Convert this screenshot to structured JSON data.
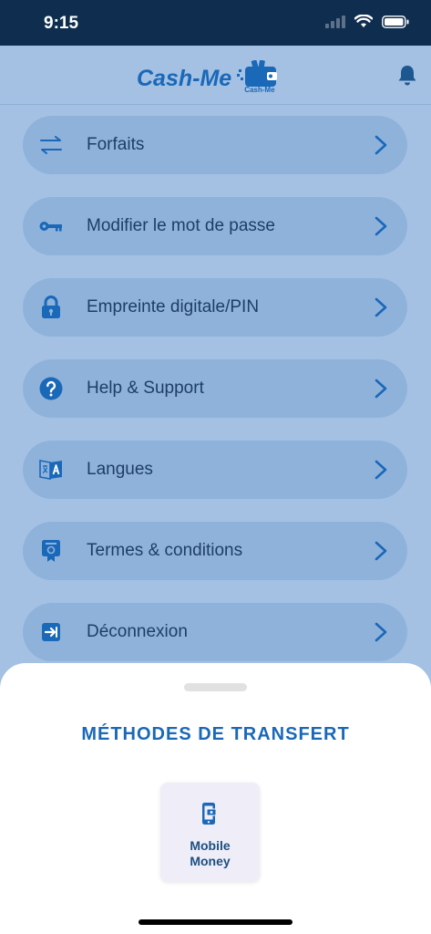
{
  "status_bar": {
    "time": "9:15"
  },
  "header": {
    "brand": "Cash-Me",
    "logo_caption": "Cash-Me"
  },
  "menu": {
    "items": [
      {
        "label": "Forfaits",
        "icon": "transfer-arrows-icon"
      },
      {
        "label": "Modifier le mot de passe",
        "icon": "key-icon"
      },
      {
        "label": "Empreinte digitale/PIN",
        "icon": "lock-icon"
      },
      {
        "label": "Help & Support",
        "icon": "help-icon"
      },
      {
        "label": "Langues",
        "icon": "translate-icon"
      },
      {
        "label": "Termes & conditions",
        "icon": "certificate-icon"
      },
      {
        "label": "Déconnexion",
        "icon": "logout-icon"
      }
    ]
  },
  "sheet": {
    "title": "MÉTHODES DE TRANSFERT",
    "methods": [
      {
        "line1": "Mobile",
        "line2": "Money",
        "icon": "mobile-money-icon"
      }
    ]
  },
  "colors": {
    "background": "#a4c1e3",
    "status_bar": "#0f2d4e",
    "accent": "#1a68b8",
    "menu_item_bg": "#8fb2db",
    "label_text": "#1d3f66"
  }
}
